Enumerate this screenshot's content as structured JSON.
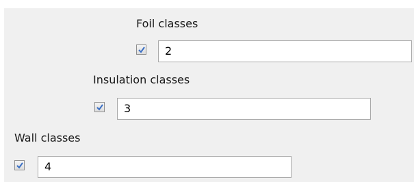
{
  "foil": {
    "label": "Foil classes",
    "checked": true,
    "value": "2"
  },
  "insulation": {
    "label": "Insulation classes",
    "checked": true,
    "value": "3"
  },
  "wall": {
    "label": "Wall classes",
    "checked": true,
    "value": "4"
  }
}
